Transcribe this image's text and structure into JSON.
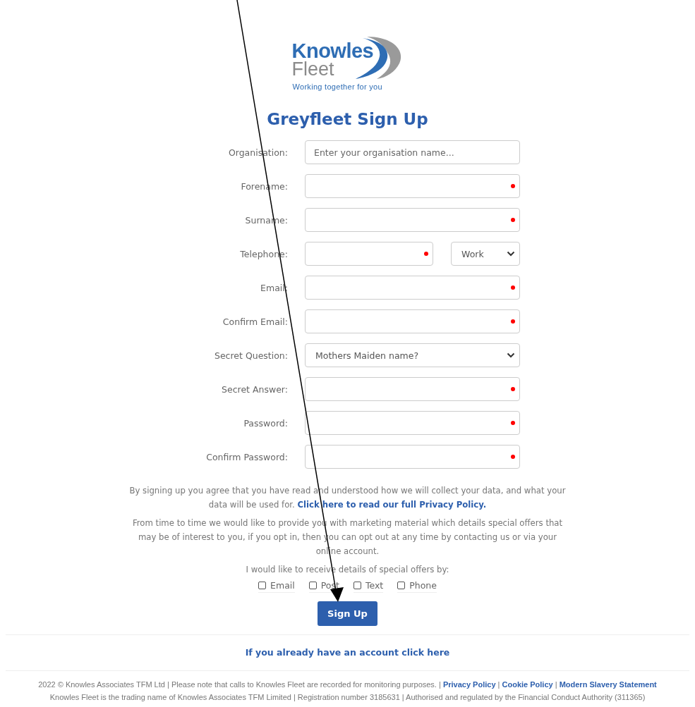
{
  "logo": {
    "name_top": "Knowles",
    "name_bottom": "Fleet",
    "tagline": "Working together for you"
  },
  "title": "Greyfleet Sign Up",
  "fields": [
    {
      "label": "Organisation:",
      "kind": "input",
      "placeholder": "Enter your organisation name...",
      "required": false
    },
    {
      "label": "Forename:",
      "kind": "input",
      "required": true
    },
    {
      "label": "Surname:",
      "kind": "input",
      "required": true
    },
    {
      "label": "Telephone:",
      "kind": "input_with_select",
      "required": true,
      "select_value": "Work"
    },
    {
      "label": "Email:",
      "kind": "input",
      "required": true
    },
    {
      "label": "Confirm Email:",
      "kind": "input",
      "required": true
    },
    {
      "label": "Secret Question:",
      "kind": "select",
      "value": "Mothers Maiden name?"
    },
    {
      "label": "Secret Answer:",
      "kind": "input",
      "required": true
    },
    {
      "label": "Password:",
      "kind": "input",
      "required": true
    },
    {
      "label": "Confirm Password:",
      "kind": "input",
      "required": true
    }
  ],
  "privacy_text": "By signing up you agree that you have read and understood how we will collect your data, and what your data will be used for.",
  "privacy_link": "Click here to read our full Privacy Policy.",
  "marketing_text": "From time to time we would like to provide you with marketing material which details special offers that may be of interest to you, if you opt in, then you can opt out at any time by contacting us or via your online account.",
  "offers_prompt": "I would like to receive details of special offers by:",
  "offer_options": [
    {
      "label": "Email",
      "checked": false
    },
    {
      "label": "Post",
      "checked": false
    },
    {
      "label": "Text",
      "checked": false
    },
    {
      "label": "Phone",
      "checked": false
    }
  ],
  "submit_button": "Sign Up",
  "login_link": "If you already have an account click here",
  "footer": {
    "copyright": "2022 © Knowles Associates TFM Ltd | Please note that calls to Knowles Fleet are recorded for monitoring purposes. |",
    "links": [
      "Privacy Policy",
      "Cookie Policy",
      "Modern Slavery Statement"
    ],
    "separator": "|",
    "legal": "Knowles Fleet is the trading name of Knowles Associates TFM Limited | Registration number 3185631 | Authorised and regulated by the Financial Conduct Authority (311365)"
  }
}
